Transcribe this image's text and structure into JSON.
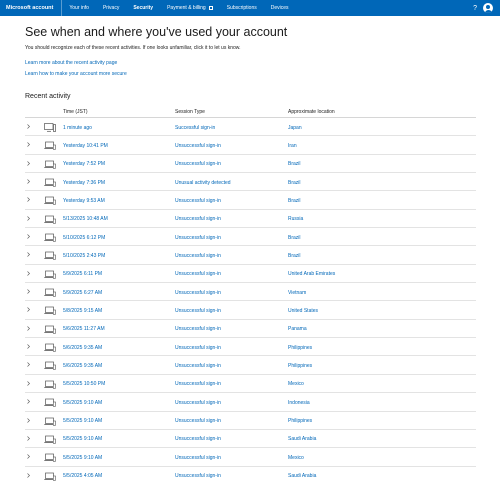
{
  "nav": {
    "brand": "Microsoft account",
    "items": [
      {
        "label": "Your info"
      },
      {
        "label": "Privacy"
      },
      {
        "label": "Security"
      },
      {
        "label": "Payment & billing"
      },
      {
        "label": "Subscriptions"
      },
      {
        "label": "Devices"
      }
    ],
    "help": "?"
  },
  "header": {
    "title": "See when and where you've used your account",
    "subtitle": "You should recognize each of these recent activities. If one looks unfamiliar, click it to let us know.",
    "link_recent": "Learn more about the recent activity page",
    "link_secure": "Learn how to make your account more secure"
  },
  "activity": {
    "section_title": "Recent activity",
    "columns": {
      "time": "Time (JST)",
      "type": "Session Type",
      "location": "Approximate location"
    },
    "rows": [
      {
        "time": "1 minute ago",
        "type": "Successful sign-in",
        "location": "Japan",
        "device": "desktop"
      },
      {
        "time": "Yesterday 10:41 PM",
        "type": "Unsuccessful sign-in",
        "location": "Iran",
        "device": "laptop"
      },
      {
        "time": "Yesterday 7:52 PM",
        "type": "Unsuccessful sign-in",
        "location": "Brazil",
        "device": "laptop"
      },
      {
        "time": "Yesterday 7:36 PM",
        "type": "Unusual activity detected",
        "location": "Brazil",
        "device": "laptop"
      },
      {
        "time": "Yesterday 9:53 AM",
        "type": "Unsuccessful sign-in",
        "location": "Brazil",
        "device": "laptop"
      },
      {
        "time": "5/13/2025 10:48 AM",
        "type": "Unsuccessful sign-in",
        "location": "Russia",
        "device": "laptop"
      },
      {
        "time": "5/10/2025 6:12 PM",
        "type": "Unsuccessful sign-in",
        "location": "Brazil",
        "device": "laptop"
      },
      {
        "time": "5/10/2025 2:43 PM",
        "type": "Unsuccessful sign-in",
        "location": "Brazil",
        "device": "laptop"
      },
      {
        "time": "5/9/2025 6:11 PM",
        "type": "Unsuccessful sign-in",
        "location": "United Arab Emirates",
        "device": "laptop"
      },
      {
        "time": "5/9/2025 6:27 AM",
        "type": "Unsuccessful sign-in",
        "location": "Vietnam",
        "device": "laptop"
      },
      {
        "time": "5/8/2025 9:15 AM",
        "type": "Unsuccessful sign-in",
        "location": "United States",
        "device": "laptop"
      },
      {
        "time": "5/6/2025 11:27 AM",
        "type": "Unsuccessful sign-in",
        "location": "Panama",
        "device": "laptop"
      },
      {
        "time": "5/6/2025 9:35 AM",
        "type": "Unsuccessful sign-in",
        "location": "Philippines",
        "device": "laptop"
      },
      {
        "time": "5/6/2025 9:35 AM",
        "type": "Unsuccessful sign-in",
        "location": "Philippines",
        "device": "laptop"
      },
      {
        "time": "5/5/2025 10:50 PM",
        "type": "Unsuccessful sign-in",
        "location": "Mexico",
        "device": "laptop"
      },
      {
        "time": "5/5/2025 9:10 AM",
        "type": "Unsuccessful sign-in",
        "location": "Indonesia",
        "device": "laptop"
      },
      {
        "time": "5/5/2025 9:10 AM",
        "type": "Unsuccessful sign-in",
        "location": "Philippines",
        "device": "laptop"
      },
      {
        "time": "5/5/2025 9:10 AM",
        "type": "Unsuccessful sign-in",
        "location": "Saudi Arabia",
        "device": "laptop"
      },
      {
        "time": "5/5/2025 9:10 AM",
        "type": "Unsuccessful sign-in",
        "location": "Mexico",
        "device": "laptop"
      },
      {
        "time": "5/5/2025 4:05 AM",
        "type": "Unsuccessful sign-in",
        "location": "Saudi Arabia",
        "device": "laptop"
      }
    ]
  },
  "colors": {
    "brand_blue": "#0067b8",
    "text": "#1b1b1b",
    "divider": "#e3e3e3"
  }
}
